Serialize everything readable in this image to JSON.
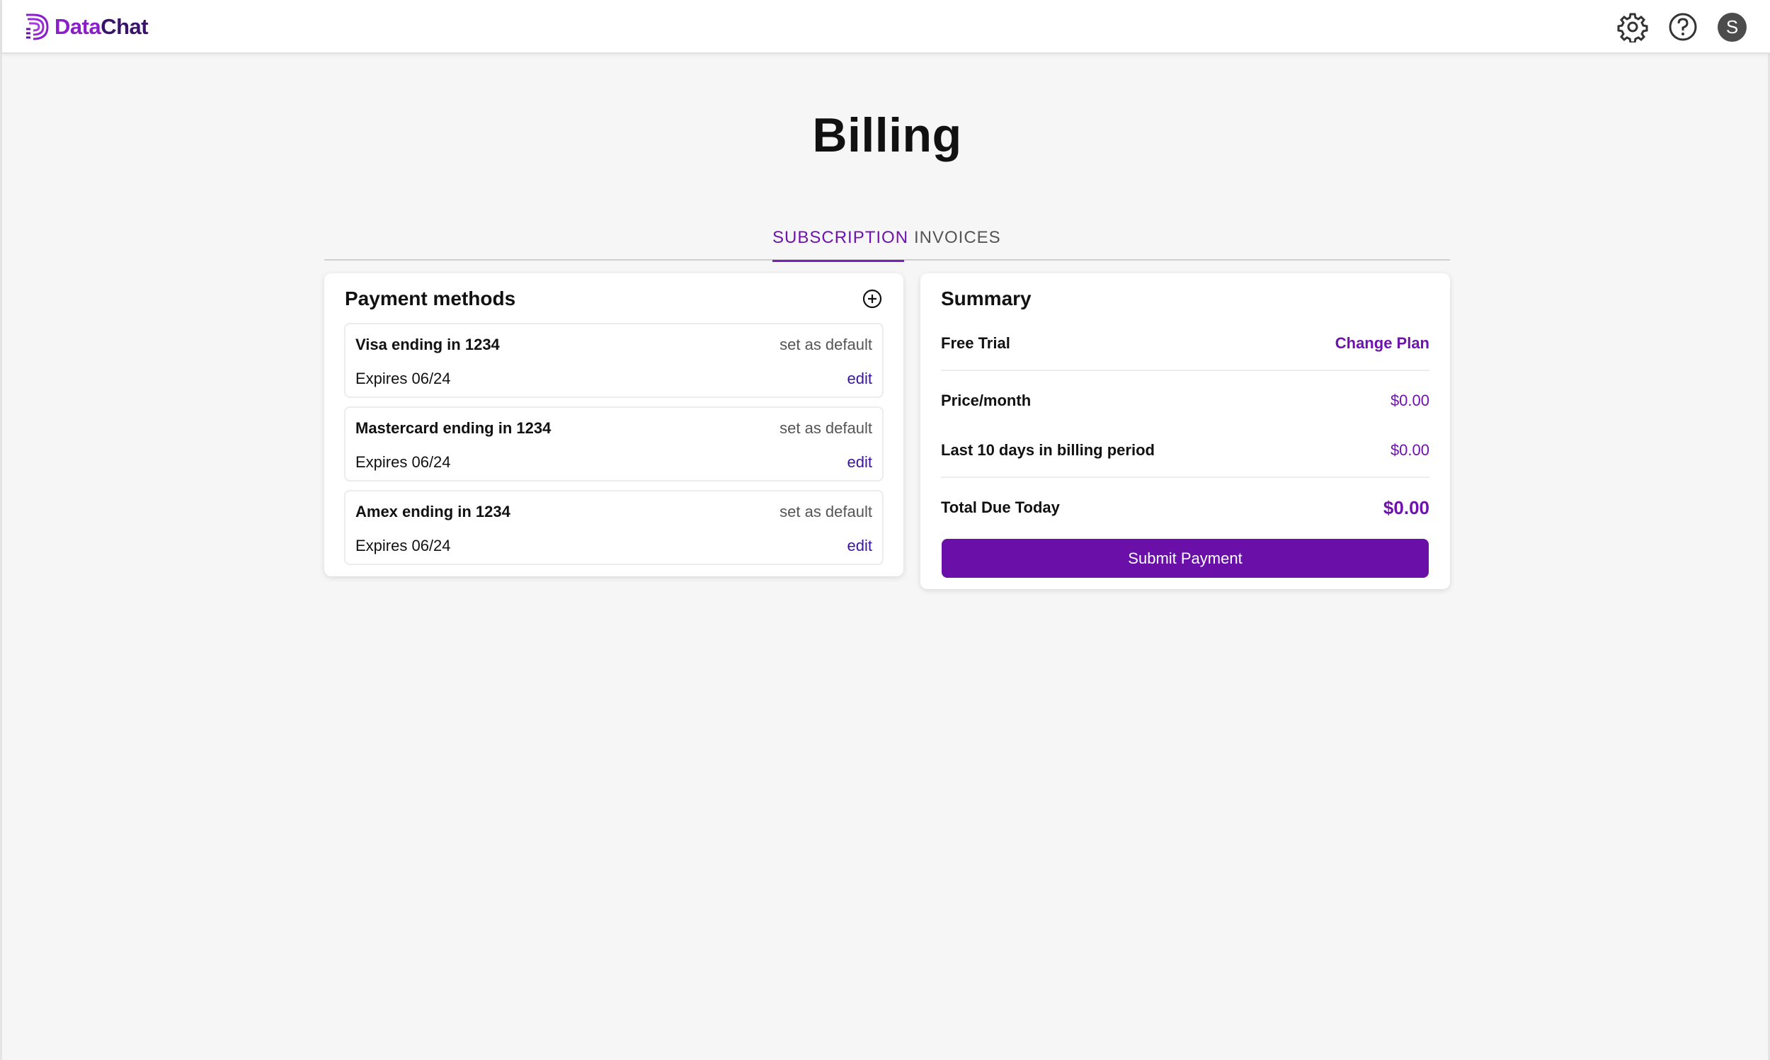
{
  "app": {
    "logo_part1": "Data",
    "logo_part2": "Chat",
    "user_initial": "S",
    "brand_color": "#6a0fa7",
    "icons": [
      "gear-icon",
      "help-icon",
      "add-circle-icon"
    ]
  },
  "page": {
    "title": "Billing"
  },
  "tabs": [
    {
      "label": "SUBSCRIPTION",
      "active": true
    },
    {
      "label": "INVOICES",
      "active": false
    }
  ],
  "payment_methods": {
    "title": "Payment methods",
    "items": [
      {
        "name": "Visa ending in 1234",
        "default_label": "set as default",
        "expires": "Expires 06/24",
        "edit_label": "edit"
      },
      {
        "name": "Mastercard ending in 1234",
        "default_label": "set as default",
        "expires": "Expires 06/24",
        "edit_label": "edit"
      },
      {
        "name": "Amex ending in 1234",
        "default_label": "set as default",
        "expires": "Expires 06/24",
        "edit_label": "edit"
      }
    ]
  },
  "summary": {
    "title": "Summary",
    "plan": "Free Trial",
    "change_plan_label": "Change Plan",
    "price_label": "Price/month",
    "price_value": "$0.00",
    "period_label": "Last 10 days in billing period",
    "period_value": "$0.00",
    "total_label": "Total Due Today",
    "total_value": "$0.00",
    "submit_label": "Submit Payment"
  }
}
